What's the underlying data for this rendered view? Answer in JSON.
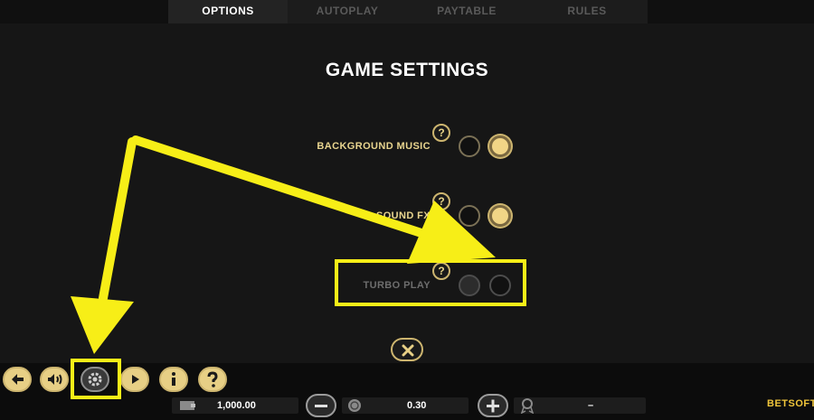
{
  "tabs": [
    {
      "label": "OPTIONS",
      "active": true
    },
    {
      "label": "AUTOPLAY",
      "active": false
    },
    {
      "label": "PAYTABLE",
      "active": false
    },
    {
      "label": "RULES",
      "active": false
    }
  ],
  "title": "GAME SETTINGS",
  "settings": [
    {
      "label": "BACKGROUND MUSIC",
      "help": "?",
      "enabled": true
    },
    {
      "label": "SOUND FX",
      "help": "?",
      "enabled": true
    },
    {
      "label": "TURBO PLAY",
      "help": "?",
      "enabled": false
    }
  ],
  "bottom": {
    "balance": "1,000.00",
    "bet": "0.30",
    "win": "–",
    "brand_prefix": "BET",
    "brand_suffix": "SOFT"
  },
  "colors": {
    "accent_gold": "#cdb56f",
    "annotation_yellow": "#f7ee17",
    "background": "#161616"
  }
}
